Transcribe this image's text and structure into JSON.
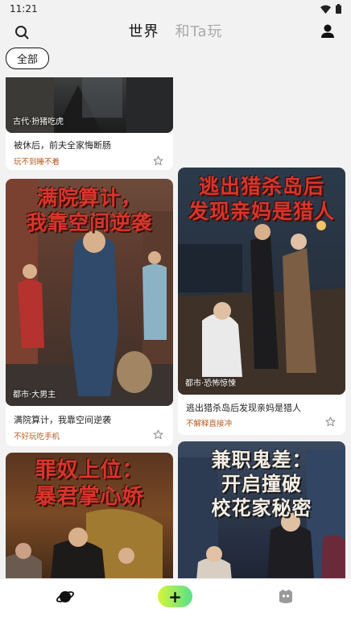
{
  "status": {
    "time": "11:21"
  },
  "header": {
    "tabs": [
      {
        "label": "世界",
        "active": true
      },
      {
        "label": "和Ta玩",
        "active": false
      }
    ]
  },
  "filter": {
    "label": "全部"
  },
  "cards": [
    {
      "cover_title": "",
      "genre": "古代·扮猪吃虎",
      "title": "被休后，前夫全家悔断肠",
      "tag": "玩不到睡不着"
    },
    {
      "cover_title": "满院算计，\n我靠空间逆袭",
      "genre": "都市·大男主",
      "title": "满院算计，我靠空间逆袭",
      "tag": "不好玩吃手机"
    },
    {
      "cover_title": "逃出猎杀岛后\n发现亲妈是猎人",
      "genre": "都市·恐怖惊悚",
      "title": "逃出猎杀岛后发现亲妈是猎人",
      "tag": "不解释直接冲"
    },
    {
      "cover_title": "罪奴上位：\n暴君掌心娇",
      "genre": "",
      "title": "",
      "tag": ""
    },
    {
      "cover_title": "兼职鬼差：\n开启撞破\n校花家秘密",
      "genre": "",
      "title": "",
      "tag": ""
    }
  ],
  "bottom_nav": {
    "create_label": "+"
  },
  "colors": {
    "accent_tag": "#b35a1e",
    "cover_title": "#d9352b",
    "create_gradient": [
      "#d6f53a",
      "#55e08a"
    ]
  }
}
